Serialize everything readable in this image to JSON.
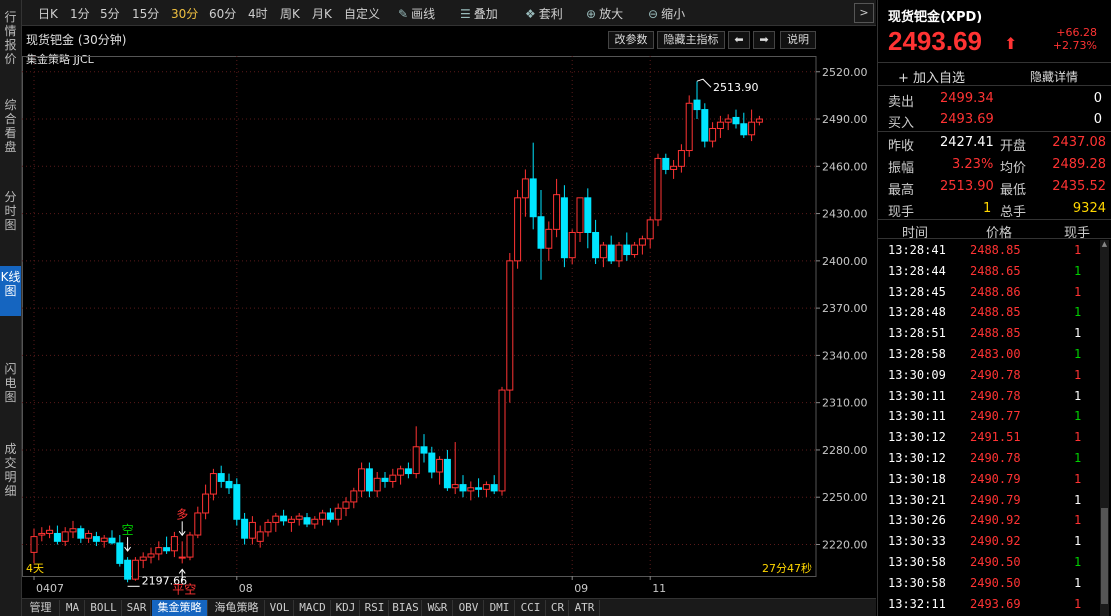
{
  "left_tabs": [
    "行情报价",
    "综合看盘",
    "分时图",
    "K线图",
    "闪电图",
    "成交明细"
  ],
  "left_tabs_active": "K线图",
  "toolbar": {
    "periods": [
      "日K",
      "1分",
      "5分",
      "15分",
      "30分",
      "60分",
      "4时",
      "周K",
      "月K",
      "自定义"
    ],
    "active_period": "30分",
    "draw": "画线",
    "overlay": "叠加",
    "arbitrage": "套利",
    "zoom_in": "放大",
    "zoom_out": "缩小"
  },
  "chart_header": {
    "title": "现货钯金 (30分钟)",
    "params_btn": "改参数",
    "hide_main_btn": "隐藏主指标",
    "prev_icon": "arrow-left-icon",
    "next_icon": "arrow-right-icon",
    "help_btn": "说明",
    "strategy_label": "集金策略 JJCL"
  },
  "chart_footer": {
    "period_span": "4天",
    "countdown": "27分47秒"
  },
  "annotations": {
    "high": "2513.90",
    "low": "2197.66",
    "signal_short_1": "空",
    "signal_long": "多",
    "signal_flat_short": "平空"
  },
  "bottom_tabs": [
    "管理",
    "MA",
    "BOLL",
    "SAR",
    "集金策略",
    "海龟策略",
    "VOL",
    "MACD",
    "KDJ",
    "RSI",
    "BIAS",
    "W&R",
    "OBV",
    "DMI",
    "CCI",
    "CR",
    "ATR"
  ],
  "bottom_tabs_active": "集金策略",
  "quote": {
    "name": "现货钯金(XPD)",
    "price": "2493.69",
    "change": "+66.28",
    "change_pct": "+2.73%",
    "add_favorite": "加入自选",
    "hide_detail": "隐藏详情",
    "sell_label": "卖出",
    "sell_price": "2499.34",
    "sell_vol": "0",
    "buy_label": "买入",
    "buy_price": "2493.69",
    "buy_vol": "0",
    "prev_close_label": "昨收",
    "prev_close": "2427.41",
    "open_label": "开盘",
    "open": "2437.08",
    "amplitude_label": "振幅",
    "amplitude": "3.23%",
    "avg_label": "均价",
    "avg": "2489.28",
    "high_label": "最高",
    "high": "2513.90",
    "low_label": "最低",
    "low": "2435.52",
    "cur_vol_label": "现手",
    "cur_vol": "1",
    "total_vol_label": "总手",
    "total_vol": "9324"
  },
  "trades_header": [
    "时间",
    "价格",
    "现手"
  ],
  "trades": [
    {
      "time": "13:28:41",
      "price": "2488.85",
      "vol": "1",
      "vol_color": "red"
    },
    {
      "time": "13:28:44",
      "price": "2488.65",
      "vol": "1",
      "vol_color": "green"
    },
    {
      "time": "13:28:45",
      "price": "2488.86",
      "vol": "1",
      "vol_color": "red"
    },
    {
      "time": "13:28:48",
      "price": "2488.85",
      "vol": "1",
      "vol_color": "green"
    },
    {
      "time": "13:28:51",
      "price": "2488.85",
      "vol": "1",
      "vol_color": "white"
    },
    {
      "time": "13:28:58",
      "price": "2483.00",
      "vol": "1",
      "vol_color": "green"
    },
    {
      "time": "13:30:09",
      "price": "2490.78",
      "vol": "1",
      "vol_color": "red"
    },
    {
      "time": "13:30:11",
      "price": "2490.78",
      "vol": "1",
      "vol_color": "white"
    },
    {
      "time": "13:30:11",
      "price": "2490.77",
      "vol": "1",
      "vol_color": "green"
    },
    {
      "time": "13:30:12",
      "price": "2491.51",
      "vol": "1",
      "vol_color": "red"
    },
    {
      "time": "13:30:12",
      "price": "2490.78",
      "vol": "1",
      "vol_color": "green"
    },
    {
      "time": "13:30:18",
      "price": "2490.79",
      "vol": "1",
      "vol_color": "red"
    },
    {
      "time": "13:30:21",
      "price": "2490.79",
      "vol": "1",
      "vol_color": "white"
    },
    {
      "time": "13:30:26",
      "price": "2490.92",
      "vol": "1",
      "vol_color": "red"
    },
    {
      "time": "13:30:33",
      "price": "2490.92",
      "vol": "1",
      "vol_color": "white"
    },
    {
      "time": "13:30:58",
      "price": "2490.50",
      "vol": "1",
      "vol_color": "green"
    },
    {
      "time": "13:30:58",
      "price": "2490.50",
      "vol": "1",
      "vol_color": "white"
    },
    {
      "time": "13:32:11",
      "price": "2493.69",
      "vol": "1",
      "vol_color": "red"
    }
  ],
  "colors": {
    "up": "#ff3333",
    "down": "#00e5ff",
    "grid": "#5a1a1a",
    "axis": "#c8c8c8",
    "accent": "#1565c0"
  },
  "chart_data": {
    "type": "candlestick",
    "title": "现货钯金 (30分钟)",
    "xlabel": "",
    "ylabel": "",
    "ylim": [
      2200,
      2530
    ],
    "y_ticks": [
      2220,
      2250,
      2280,
      2310,
      2340,
      2370,
      2400,
      2430,
      2460,
      2490,
      2520
    ],
    "x_labels": [
      {
        "label": "0407",
        "index": 0
      },
      {
        "label": "08",
        "index": 26
      },
      {
        "label": "09",
        "index": 69
      },
      {
        "label": "11",
        "index": 79
      }
    ],
    "candles": [
      {
        "o": 2215,
        "h": 2230,
        "l": 2208,
        "c": 2225
      },
      {
        "o": 2226,
        "h": 2231,
        "l": 2222,
        "c": 2227
      },
      {
        "o": 2227,
        "h": 2232,
        "l": 2224,
        "c": 2229
      },
      {
        "o": 2227,
        "h": 2232,
        "l": 2220,
        "c": 2222
      },
      {
        "o": 2222,
        "h": 2231,
        "l": 2219,
        "c": 2228
      },
      {
        "o": 2228,
        "h": 2235,
        "l": 2224,
        "c": 2230
      },
      {
        "o": 2230,
        "h": 2232,
        "l": 2221,
        "c": 2224
      },
      {
        "o": 2224,
        "h": 2229,
        "l": 2221,
        "c": 2227
      },
      {
        "o": 2225,
        "h": 2228,
        "l": 2219,
        "c": 2222
      },
      {
        "o": 2222,
        "h": 2226,
        "l": 2218,
        "c": 2224
      },
      {
        "o": 2224,
        "h": 2229,
        "l": 2220,
        "c": 2221
      },
      {
        "o": 2221,
        "h": 2226,
        "l": 2206,
        "c": 2208
      },
      {
        "o": 2210,
        "h": 2212,
        "l": 2196,
        "c": 2198
      },
      {
        "o": 2198,
        "h": 2212,
        "l": 2197,
        "c": 2210
      },
      {
        "o": 2210,
        "h": 2215,
        "l": 2205,
        "c": 2212
      },
      {
        "o": 2212,
        "h": 2218,
        "l": 2208,
        "c": 2214
      },
      {
        "o": 2214,
        "h": 2222,
        "l": 2210,
        "c": 2218
      },
      {
        "o": 2218,
        "h": 2225,
        "l": 2214,
        "c": 2216
      },
      {
        "o": 2216,
        "h": 2228,
        "l": 2212,
        "c": 2225
      },
      {
        "o": 2212,
        "h": 2222,
        "l": 2208,
        "c": 2212
      },
      {
        "o": 2212,
        "h": 2228,
        "l": 2210,
        "c": 2226
      },
      {
        "o": 2226,
        "h": 2244,
        "l": 2224,
        "c": 2240
      },
      {
        "o": 2240,
        "h": 2258,
        "l": 2236,
        "c": 2252
      },
      {
        "o": 2252,
        "h": 2268,
        "l": 2248,
        "c": 2265
      },
      {
        "o": 2265,
        "h": 2270,
        "l": 2256,
        "c": 2260
      },
      {
        "o": 2260,
        "h": 2265,
        "l": 2252,
        "c": 2256
      },
      {
        "o": 2258,
        "h": 2262,
        "l": 2232,
        "c": 2236
      },
      {
        "o": 2236,
        "h": 2240,
        "l": 2220,
        "c": 2224
      },
      {
        "o": 2224,
        "h": 2238,
        "l": 2220,
        "c": 2234
      },
      {
        "o": 2222,
        "h": 2232,
        "l": 2218,
        "c": 2228
      },
      {
        "o": 2228,
        "h": 2236,
        "l": 2225,
        "c": 2234
      },
      {
        "o": 2234,
        "h": 2240,
        "l": 2228,
        "c": 2238
      },
      {
        "o": 2238,
        "h": 2242,
        "l": 2232,
        "c": 2235
      },
      {
        "o": 2234,
        "h": 2238,
        "l": 2228,
        "c": 2236
      },
      {
        "o": 2236,
        "h": 2240,
        "l": 2232,
        "c": 2238
      },
      {
        "o": 2237,
        "h": 2240,
        "l": 2231,
        "c": 2233
      },
      {
        "o": 2233,
        "h": 2238,
        "l": 2230,
        "c": 2236
      },
      {
        "o": 2236,
        "h": 2242,
        "l": 2232,
        "c": 2240
      },
      {
        "o": 2240,
        "h": 2243,
        "l": 2234,
        "c": 2236
      },
      {
        "o": 2236,
        "h": 2246,
        "l": 2232,
        "c": 2243
      },
      {
        "o": 2243,
        "h": 2250,
        "l": 2238,
        "c": 2247
      },
      {
        "o": 2247,
        "h": 2256,
        "l": 2243,
        "c": 2254
      },
      {
        "o": 2254,
        "h": 2272,
        "l": 2250,
        "c": 2268
      },
      {
        "o": 2268,
        "h": 2272,
        "l": 2250,
        "c": 2254
      },
      {
        "o": 2254,
        "h": 2266,
        "l": 2250,
        "c": 2262
      },
      {
        "o": 2262,
        "h": 2266,
        "l": 2256,
        "c": 2260
      },
      {
        "o": 2260,
        "h": 2268,
        "l": 2256,
        "c": 2264
      },
      {
        "o": 2264,
        "h": 2270,
        "l": 2258,
        "c": 2268
      },
      {
        "o": 2268,
        "h": 2272,
        "l": 2262,
        "c": 2265
      },
      {
        "o": 2265,
        "h": 2295,
        "l": 2262,
        "c": 2282
      },
      {
        "o": 2282,
        "h": 2290,
        "l": 2272,
        "c": 2278
      },
      {
        "o": 2278,
        "h": 2282,
        "l": 2262,
        "c": 2266
      },
      {
        "o": 2266,
        "h": 2276,
        "l": 2258,
        "c": 2274
      },
      {
        "o": 2274,
        "h": 2280,
        "l": 2254,
        "c": 2256
      },
      {
        "o": 2256,
        "h": 2285,
        "l": 2252,
        "c": 2258
      },
      {
        "o": 2258,
        "h": 2264,
        "l": 2250,
        "c": 2254
      },
      {
        "o": 2254,
        "h": 2260,
        "l": 2248,
        "c": 2256
      },
      {
        "o": 2256,
        "h": 2262,
        "l": 2250,
        "c": 2255
      },
      {
        "o": 2255,
        "h": 2260,
        "l": 2250,
        "c": 2258
      },
      {
        "o": 2258,
        "h": 2264,
        "l": 2252,
        "c": 2254
      },
      {
        "o": 2254,
        "h": 2320,
        "l": 2251,
        "c": 2318
      },
      {
        "o": 2318,
        "h": 2405,
        "l": 2310,
        "c": 2400
      },
      {
        "o": 2400,
        "h": 2445,
        "l": 2395,
        "c": 2440
      },
      {
        "o": 2440,
        "h": 2458,
        "l": 2428,
        "c": 2452
      },
      {
        "o": 2452,
        "h": 2475,
        "l": 2420,
        "c": 2428
      },
      {
        "o": 2428,
        "h": 2445,
        "l": 2388,
        "c": 2408
      },
      {
        "o": 2408,
        "h": 2425,
        "l": 2400,
        "c": 2420
      },
      {
        "o": 2420,
        "h": 2452,
        "l": 2415,
        "c": 2442
      },
      {
        "o": 2440,
        "h": 2448,
        "l": 2396,
        "c": 2402
      },
      {
        "o": 2402,
        "h": 2420,
        "l": 2398,
        "c": 2418
      },
      {
        "o": 2418,
        "h": 2440,
        "l": 2412,
        "c": 2440
      },
      {
        "o": 2440,
        "h": 2446,
        "l": 2408,
        "c": 2418
      },
      {
        "o": 2418,
        "h": 2426,
        "l": 2398,
        "c": 2402
      },
      {
        "o": 2402,
        "h": 2412,
        "l": 2396,
        "c": 2410
      },
      {
        "o": 2410,
        "h": 2416,
        "l": 2398,
        "c": 2400
      },
      {
        "o": 2400,
        "h": 2412,
        "l": 2396,
        "c": 2410
      },
      {
        "o": 2410,
        "h": 2418,
        "l": 2400,
        "c": 2404
      },
      {
        "o": 2404,
        "h": 2412,
        "l": 2402,
        "c": 2410
      },
      {
        "o": 2410,
        "h": 2416,
        "l": 2404,
        "c": 2414
      },
      {
        "o": 2414,
        "h": 2428,
        "l": 2408,
        "c": 2426
      },
      {
        "o": 2426,
        "h": 2468,
        "l": 2422,
        "c": 2465
      },
      {
        "o": 2465,
        "h": 2468,
        "l": 2455,
        "c": 2458
      },
      {
        "o": 2458,
        "h": 2464,
        "l": 2452,
        "c": 2460
      },
      {
        "o": 2460,
        "h": 2474,
        "l": 2456,
        "c": 2470
      },
      {
        "o": 2470,
        "h": 2505,
        "l": 2466,
        "c": 2500
      },
      {
        "o": 2502,
        "h": 2514,
        "l": 2490,
        "c": 2496
      },
      {
        "o": 2496,
        "h": 2500,
        "l": 2472,
        "c": 2476
      },
      {
        "o": 2476,
        "h": 2488,
        "l": 2472,
        "c": 2484
      },
      {
        "o": 2484,
        "h": 2492,
        "l": 2478,
        "c": 2488
      },
      {
        "o": 2488,
        "h": 2493,
        "l": 2483,
        "c": 2490
      },
      {
        "o": 2491,
        "h": 2496,
        "l": 2484,
        "c": 2487
      },
      {
        "o": 2487,
        "h": 2494,
        "l": 2478,
        "c": 2480
      },
      {
        "o": 2480,
        "h": 2496,
        "l": 2476,
        "c": 2488
      },
      {
        "o": 2488,
        "h": 2492,
        "l": 2486,
        "c": 2490
      }
    ]
  }
}
